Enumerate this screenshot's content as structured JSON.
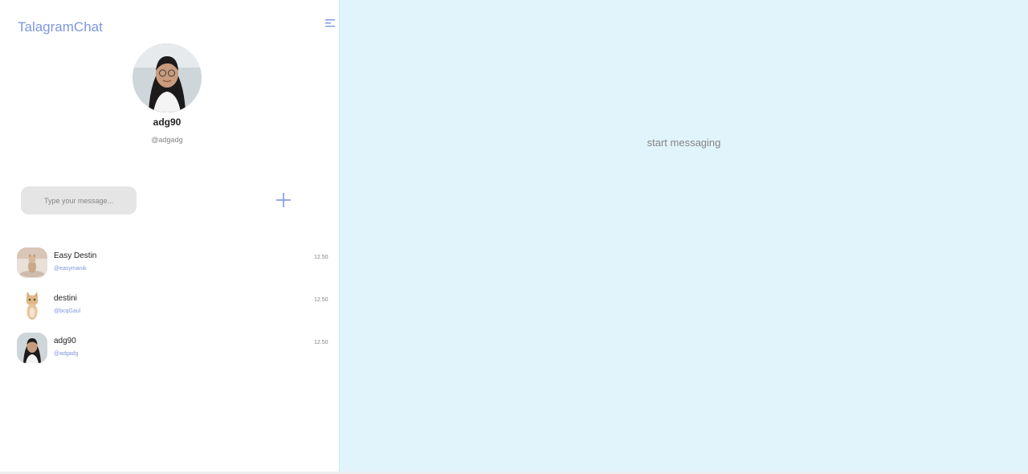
{
  "app": {
    "title": "TalagramChat"
  },
  "sidebar": {
    "menu_icon": "menu-lines-icon",
    "profile": {
      "name": "adg90",
      "handle": "@adgadg"
    },
    "search": {
      "placeholder": "Type your message..."
    },
    "add_icon": "plus-icon",
    "chats": [
      {
        "name": "Easy Destin",
        "handle": "@easymanik",
        "time": "12.50"
      },
      {
        "name": "destini",
        "handle": "@bcqGaul",
        "time": "12.50"
      },
      {
        "name": "adg90",
        "handle": "@adgadg",
        "time": "12.50"
      }
    ]
  },
  "main": {
    "empty_text": "start messaging"
  },
  "colors": {
    "accent": "#7E98DF",
    "chat_background": "#E1F4FC",
    "search_background": "#E5E5E5"
  }
}
